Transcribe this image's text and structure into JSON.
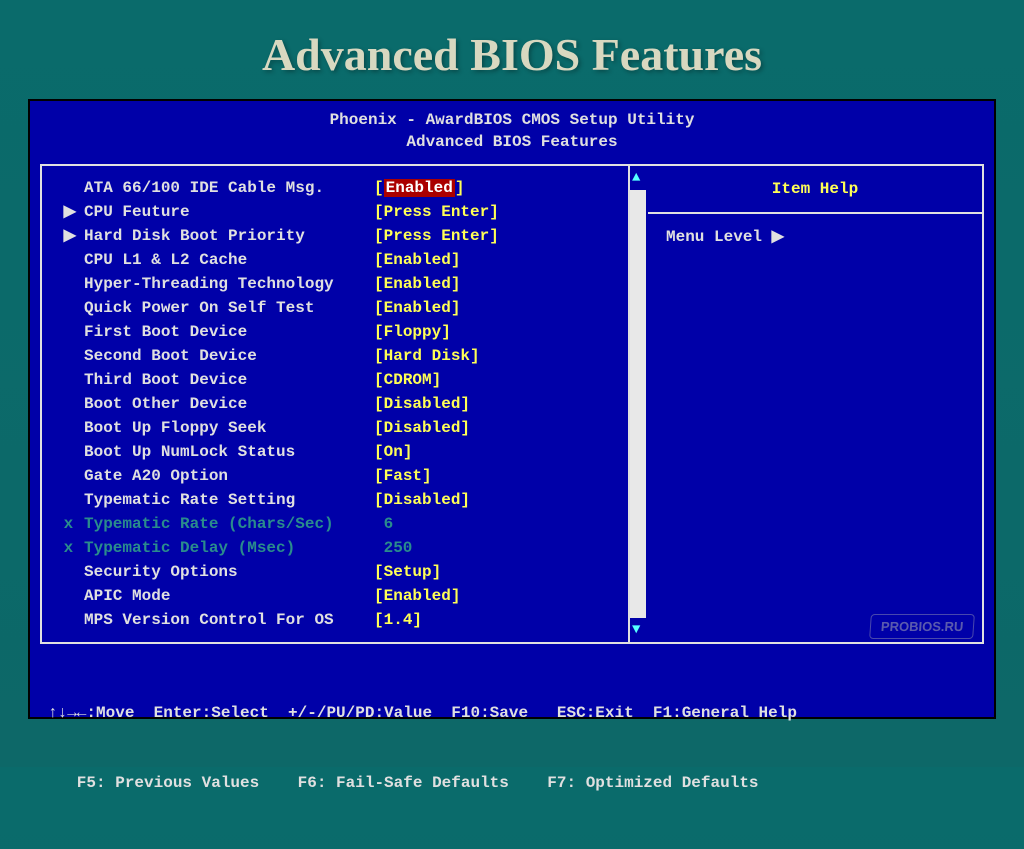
{
  "slide_title": "Advanced BIOS Features",
  "header": {
    "line1": "Phoenix - AwardBIOS CMOS Setup Utility",
    "line2": "Advanced BIOS Features"
  },
  "settings": [
    {
      "indent": "",
      "label": "ATA 66/100 IDE Cable Msg.",
      "value": "Enabled",
      "highlighted": true,
      "disabled": false,
      "bracket": true
    },
    {
      "indent": "▶",
      "label": "CPU Feuture",
      "value": "Press Enter",
      "highlighted": false,
      "disabled": false,
      "bracket": true
    },
    {
      "indent": "▶",
      "label": "Hard Disk Boot Priority",
      "value": "Press Enter",
      "highlighted": false,
      "disabled": false,
      "bracket": true
    },
    {
      "indent": "",
      "label": "CPU L1 & L2 Cache",
      "value": "Enabled",
      "highlighted": false,
      "disabled": false,
      "bracket": true
    },
    {
      "indent": "",
      "label": "Hyper-Threading Technology",
      "value": "Enabled",
      "highlighted": false,
      "disabled": false,
      "bracket": true
    },
    {
      "indent": "",
      "label": "Quick Power On Self Test",
      "value": "Enabled",
      "highlighted": false,
      "disabled": false,
      "bracket": true
    },
    {
      "indent": "",
      "label": "First Boot Device",
      "value": "Floppy",
      "highlighted": false,
      "disabled": false,
      "bracket": true
    },
    {
      "indent": "",
      "label": "Second Boot Device",
      "value": "Hard Disk",
      "highlighted": false,
      "disabled": false,
      "bracket": true
    },
    {
      "indent": "",
      "label": "Third Boot Device",
      "value": "CDROM",
      "highlighted": false,
      "disabled": false,
      "bracket": true
    },
    {
      "indent": "",
      "label": "Boot Other Device",
      "value": "Disabled",
      "highlighted": false,
      "disabled": false,
      "bracket": true
    },
    {
      "indent": "",
      "label": "Boot Up Floppy Seek",
      "value": "Disabled",
      "highlighted": false,
      "disabled": false,
      "bracket": true
    },
    {
      "indent": "",
      "label": "Boot Up NumLock Status",
      "value": "On",
      "highlighted": false,
      "disabled": false,
      "bracket": true
    },
    {
      "indent": "",
      "label": "Gate A20 Option",
      "value": "Fast",
      "highlighted": false,
      "disabled": false,
      "bracket": true
    },
    {
      "indent": "",
      "label": "Typematic Rate Setting",
      "value": "Disabled",
      "highlighted": false,
      "disabled": false,
      "bracket": true
    },
    {
      "indent": "x",
      "label": "Typematic Rate (Chars/Sec)",
      "value": "6",
      "highlighted": false,
      "disabled": true,
      "bracket": false
    },
    {
      "indent": "x",
      "label": "Typematic Delay (Msec)",
      "value": "250",
      "highlighted": false,
      "disabled": true,
      "bracket": false
    },
    {
      "indent": "",
      "label": "Security Options",
      "value": "Setup",
      "highlighted": false,
      "disabled": false,
      "bracket": true
    },
    {
      "indent": "",
      "label": "APIC Mode",
      "value": "Enabled",
      "highlighted": false,
      "disabled": false,
      "bracket": true
    },
    {
      "indent": "",
      "label": "MPS Version Control For OS",
      "value": "1.4",
      "highlighted": false,
      "disabled": false,
      "bracket": true
    }
  ],
  "help": {
    "title": "Item Help",
    "menu_level": "Menu Level    ▶"
  },
  "footer": {
    "line1": "↑↓→←:Move  Enter:Select  +/-/PU/PD:Value  F10:Save   ESC:Exit  F1:General Help",
    "line2": "   F5: Previous Values    F6: Fail-Safe Defaults    F7: Optimized Defaults"
  },
  "watermark": "PROBIOS.RU"
}
